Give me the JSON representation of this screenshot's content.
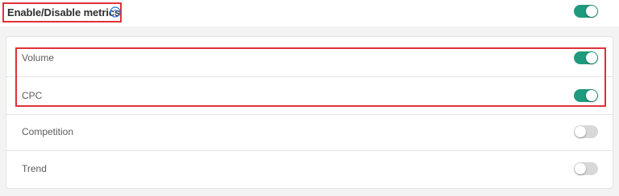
{
  "header": {
    "title": "Enable/Disable metrics",
    "help_icon": "question-circle-icon",
    "toggle_on": true
  },
  "metrics": [
    {
      "label": "Volume",
      "enabled": true
    },
    {
      "label": "CPC",
      "enabled": true
    },
    {
      "label": "Competition",
      "enabled": false
    },
    {
      "label": "Trend",
      "enabled": false
    }
  ],
  "colors": {
    "toggle_on": "#1f9a7d",
    "toggle_off": "#d8d8d8",
    "highlight_border": "#e0313a",
    "help_icon": "#1e73d8"
  }
}
